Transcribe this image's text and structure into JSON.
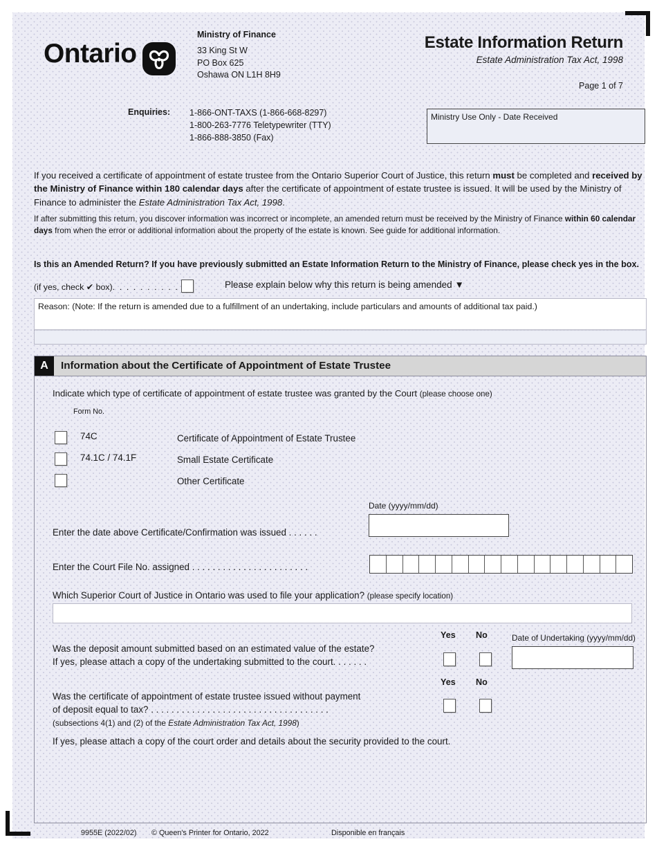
{
  "header": {
    "wordmark": "Ontario",
    "ministry_name": "Ministry of Finance",
    "address_line1": "33 King St W",
    "address_line2": "PO Box 625",
    "address_line3": "Oshawa ON  L1H 8H9",
    "form_title": "Estate Information Return",
    "form_subtitle": "Estate Administration Tax Act, 1998",
    "page_indicator": "Page 1 of 7"
  },
  "enquiries": {
    "label": "Enquiries:",
    "line1": "1-866-ONT-TAXS  (1-866-668-8297)",
    "line2": "1-800-263-7776 Teletypewriter (TTY)",
    "line3": "1-866-888-3850 (Fax)"
  },
  "ministry_use": {
    "label": "Ministry Use Only - Date Received",
    "value": ""
  },
  "intro": {
    "p1_a": "If you received a certificate of appointment of estate trustee from the Ontario Superior Court of Justice, this return ",
    "p1_must": "must",
    "p1_b": " be completed and ",
    "p1_bold2": "received by the Ministry of Finance within 180 calendar days",
    "p1_c": " after the certificate of appointment of estate trustee is issued. It will be used by the Ministry of Finance to administer the ",
    "p1_italic": "Estate Administration Tax Act, 1998",
    "p1_d": ".",
    "p2_a": "If after submitting this return, you discover information was incorrect or incomplete, an amended return must be received by the Ministry of Finance ",
    "p2_bold": "within 60 calendar days",
    "p2_b": " from when the error or additional information about the property of the estate is known. See guide for additional information."
  },
  "amended": {
    "question": "Is this an Amended Return? If you have previously submitted an Estate Information Return to the Ministry of Finance, please check yes in the box.",
    "checkbox_hint": "(if yes, check ✔ box)",
    "dots": ". . . . . . . . . .",
    "explain": "Please explain below why this return is being amended",
    "arrow": "▼",
    "reason_label": "Reason: (Note: If the return is amended due to a fulfillment of an undertaking, include particulars and amounts of additional tax paid.)",
    "reason_value": ""
  },
  "section_a": {
    "badge": "A",
    "title": "Information about the Certificate of Appointment of Estate Trustee",
    "indicate_main": "Indicate which type of certificate of appointment of estate trustee was granted by the Court ",
    "indicate_small": "(please choose one)",
    "form_no_label": "Form No.",
    "options": [
      {
        "code": "74C",
        "description": "Certificate of Appointment of Estate Trustee",
        "checked": false
      },
      {
        "code": "74.1C / 74.1F",
        "description": "Small Estate Certificate",
        "checked": false
      },
      {
        "code": "",
        "description": "Other Certificate",
        "checked": false
      }
    ],
    "date_issued": {
      "box_label": "Date (yyyy/mm/dd)",
      "row_label": "Enter the date above Certificate/Confirmation was issued  . . . . . .",
      "value": ""
    },
    "court_file": {
      "row_label": "Enter the Court File No. assigned . . . . . . . . . . . . . . . . . . . . . . .",
      "cell_count": 16,
      "value": ""
    },
    "superior_court": {
      "question_main": "Which Superior Court of Justice in Ontario was used to file your application? ",
      "question_small": "(please specify location)",
      "value": ""
    },
    "question1": {
      "yes_label": "Yes",
      "no_label": "No",
      "line1": "Was the deposit amount submitted based on an estimated value of the estate?",
      "line2": "If yes, please attach a copy of the undertaking submitted to the court. . . . . . .",
      "answer": "",
      "undertaking_label": "Date of Undertaking (yyyy/mm/dd)",
      "undertaking_value": ""
    },
    "question2": {
      "yes_label": "Yes",
      "no_label": "No",
      "line1": "Was the certificate of appointment of estate trustee issued without payment",
      "line2": "of deposit equal to tax? . . . . . . . . . . . . . . . . . . . . . . . . . . . . . . . . . . .",
      "answer": "",
      "subsection_a": "(subsections 4(1) and (2) of the ",
      "subsection_italic": "Estate Administration Tax Act, 1998",
      "subsection_b": ")",
      "attach_note": "If yes, please attach a copy of the court order and details about the security provided to the court."
    }
  },
  "footer": {
    "form_code": "9955E (2022/02)",
    "copyright": "© Queen's Printer for Ontario, 2022",
    "french": "Disponible en français"
  },
  "colors": {
    "page_background": "#eceef6",
    "section_header": "#d6d6d6",
    "badge": "#111111",
    "text": "#1a1a1a",
    "field_background": "#ffffff"
  }
}
